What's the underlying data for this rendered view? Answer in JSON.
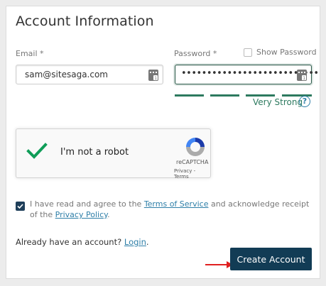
{
  "form": {
    "title": "Account Information",
    "email_label": "Email *",
    "email_value": "sam@sitesaga.com",
    "password_label": "Password *",
    "password_value": "•••••••••••••••••••••••••••",
    "show_password_label": "Show Password",
    "strength": {
      "segments_filled": 4,
      "segments_total": 4,
      "label": "Very Strong",
      "color": "#2d7a5f",
      "help_glyph": "?"
    }
  },
  "recaptcha": {
    "label": "I'm not a robot",
    "brand": "reCAPTCHA",
    "links": "Privacy - Terms",
    "checked": true
  },
  "agreement": {
    "checked": true,
    "text_before": "I have read and agree to the ",
    "tos_link": "Terms of Service",
    "text_middle": " and acknowledge receipt of the ",
    "privacy_link": "Privacy Policy",
    "text_after": "."
  },
  "login": {
    "prompt": "Already have an account? ",
    "link": "Login",
    "after": "."
  },
  "create_button_label": "Create Account",
  "colors": {
    "accent": "#2d7a5f",
    "button": "#123c55",
    "link": "#2f7fa8",
    "arrow": "#e02020"
  }
}
